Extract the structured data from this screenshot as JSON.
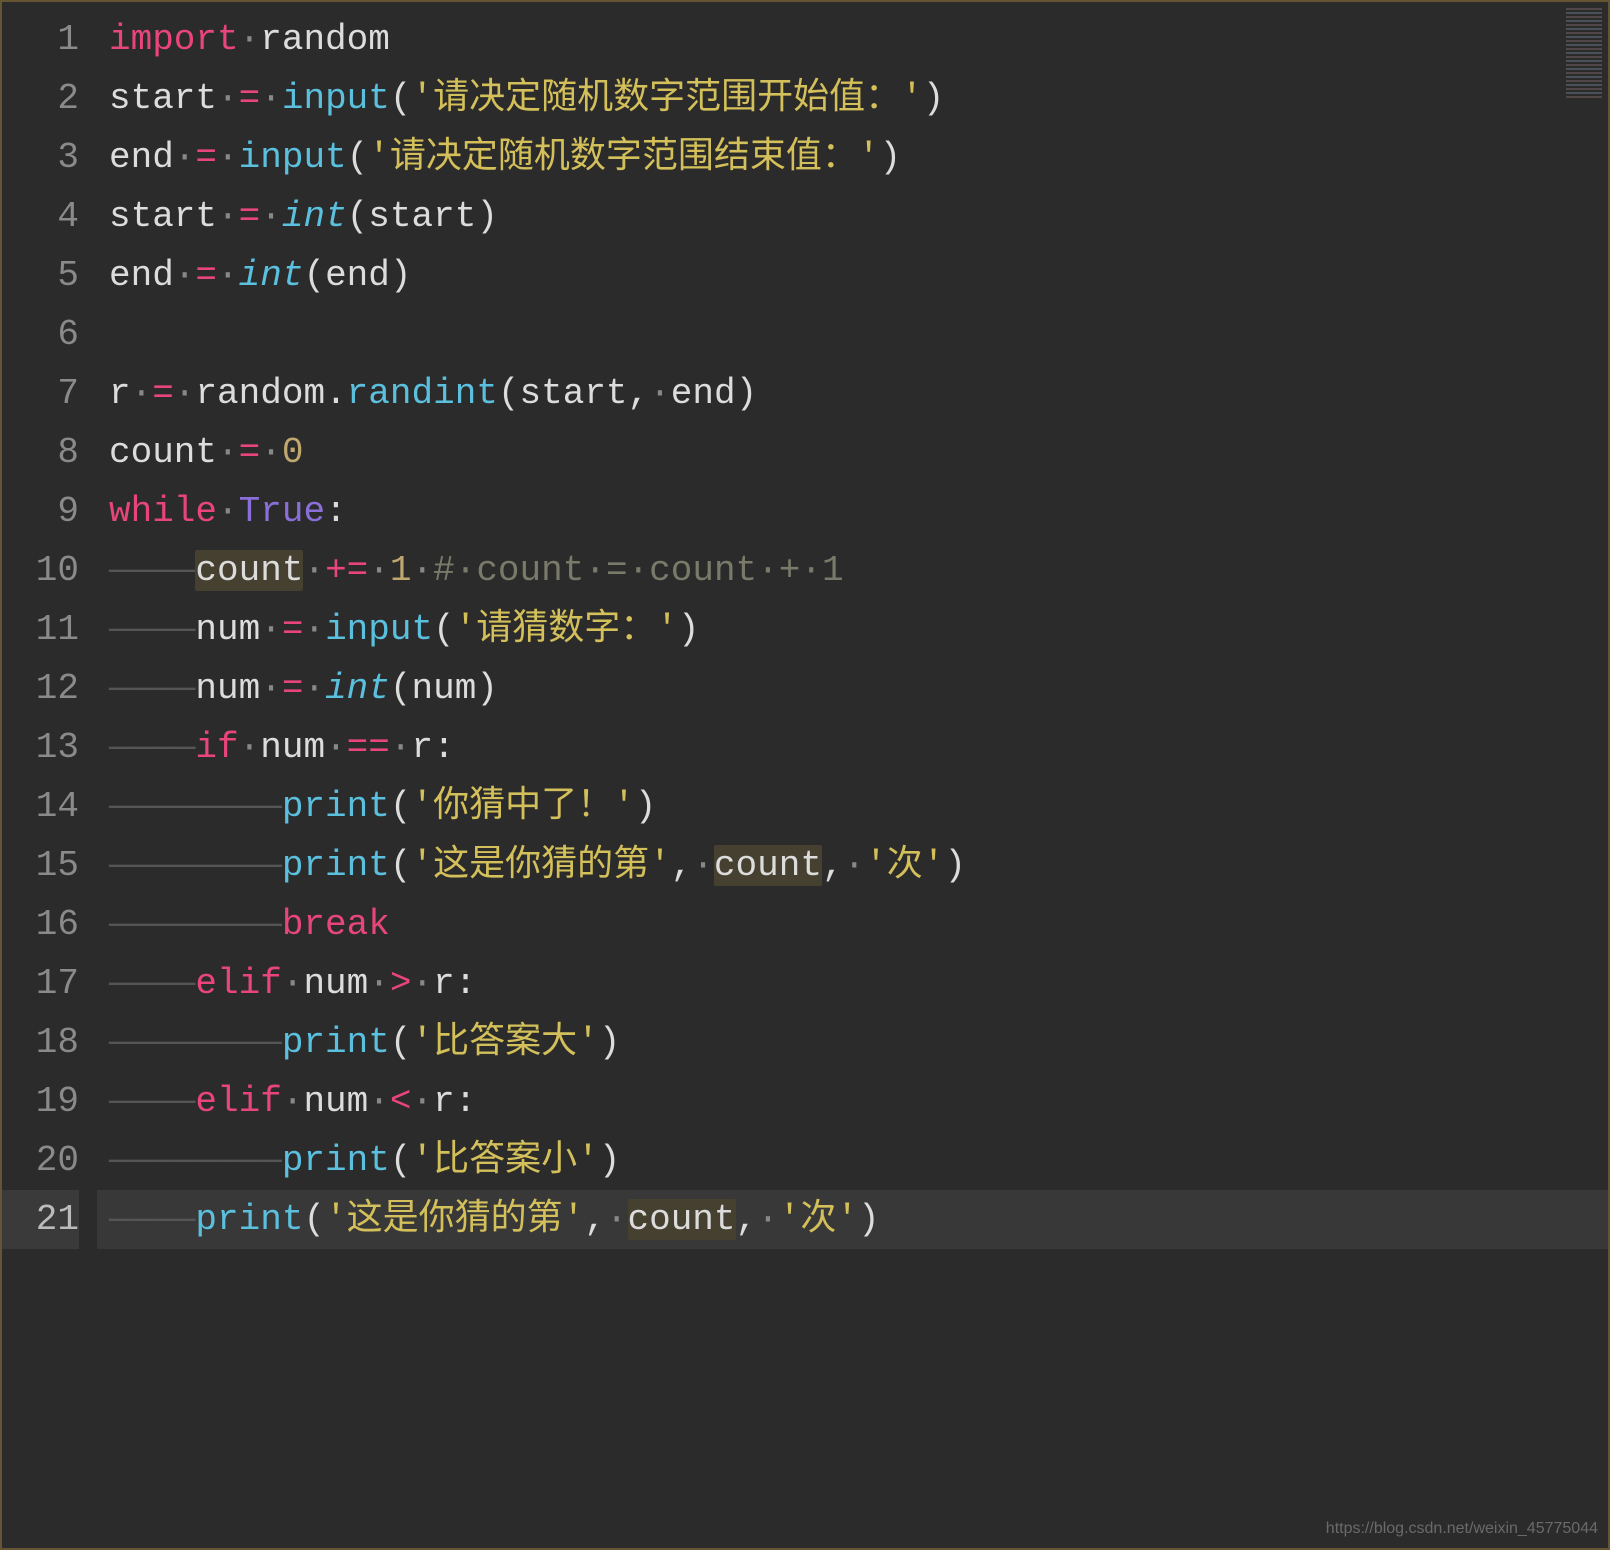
{
  "editor": {
    "line_numbers": [
      "1",
      "2",
      "3",
      "4",
      "5",
      "6",
      "7",
      "8",
      "9",
      "10",
      "11",
      "12",
      "13",
      "14",
      "15",
      "16",
      "17",
      "18",
      "19",
      "20",
      "21"
    ],
    "active_line": 21,
    "watermark": "https://blog.csdn.net/weixin_45775044",
    "tokens": [
      [
        {
          "t": "import",
          "c": "kw-import"
        },
        {
          "t": "·",
          "c": "ws-dot"
        },
        {
          "t": "random",
          "c": "ident"
        }
      ],
      [
        {
          "t": "start",
          "c": "ident"
        },
        {
          "t": "·",
          "c": "ws-dot"
        },
        {
          "t": "=",
          "c": "op"
        },
        {
          "t": "·",
          "c": "ws-dot"
        },
        {
          "t": "input",
          "c": "func-call"
        },
        {
          "t": "(",
          "c": "punct"
        },
        {
          "t": "'请决定随机数字范围开始值：'",
          "c": "string"
        },
        {
          "t": ")",
          "c": "punct"
        }
      ],
      [
        {
          "t": "end",
          "c": "ident"
        },
        {
          "t": "·",
          "c": "ws-dot"
        },
        {
          "t": "=",
          "c": "op"
        },
        {
          "t": "·",
          "c": "ws-dot"
        },
        {
          "t": "input",
          "c": "func-call"
        },
        {
          "t": "(",
          "c": "punct"
        },
        {
          "t": "'请决定随机数字范围结束值：'",
          "c": "string"
        },
        {
          "t": ")",
          "c": "punct"
        }
      ],
      [
        {
          "t": "start",
          "c": "ident"
        },
        {
          "t": "·",
          "c": "ws-dot"
        },
        {
          "t": "=",
          "c": "op"
        },
        {
          "t": "·",
          "c": "ws-dot"
        },
        {
          "t": "int",
          "c": "builtin"
        },
        {
          "t": "(",
          "c": "punct"
        },
        {
          "t": "start",
          "c": "ident"
        },
        {
          "t": ")",
          "c": "punct"
        }
      ],
      [
        {
          "t": "end",
          "c": "ident"
        },
        {
          "t": "·",
          "c": "ws-dot"
        },
        {
          "t": "=",
          "c": "op"
        },
        {
          "t": "·",
          "c": "ws-dot"
        },
        {
          "t": "int",
          "c": "builtin"
        },
        {
          "t": "(",
          "c": "punct"
        },
        {
          "t": "end",
          "c": "ident"
        },
        {
          "t": ")",
          "c": "punct"
        }
      ],
      [],
      [
        {
          "t": "r",
          "c": "ident"
        },
        {
          "t": "·",
          "c": "ws-dot"
        },
        {
          "t": "=",
          "c": "op"
        },
        {
          "t": "·",
          "c": "ws-dot"
        },
        {
          "t": "random",
          "c": "ident"
        },
        {
          "t": ".",
          "c": "punct"
        },
        {
          "t": "randint",
          "c": "func-call"
        },
        {
          "t": "(",
          "c": "punct"
        },
        {
          "t": "start",
          "c": "ident"
        },
        {
          "t": ",",
          "c": "punct"
        },
        {
          "t": "·",
          "c": "ws-dot"
        },
        {
          "t": "end",
          "c": "ident"
        },
        {
          "t": ")",
          "c": "punct"
        }
      ],
      [
        {
          "t": "count",
          "c": "ident"
        },
        {
          "t": "·",
          "c": "ws-dot"
        },
        {
          "t": "=",
          "c": "op"
        },
        {
          "t": "·",
          "c": "ws-dot"
        },
        {
          "t": "0",
          "c": "number"
        }
      ],
      [
        {
          "t": "while",
          "c": "kw-control"
        },
        {
          "t": "·",
          "c": "ws-dot"
        },
        {
          "t": "True",
          "c": "kw-bool"
        },
        {
          "t": ":",
          "c": "punct"
        }
      ],
      [
        {
          "t": "————",
          "c": "indent-guide"
        },
        {
          "t": "count",
          "c": "ident hl"
        },
        {
          "t": "·",
          "c": "ws-dot"
        },
        {
          "t": "+=",
          "c": "op"
        },
        {
          "t": "·",
          "c": "ws-dot"
        },
        {
          "t": "1",
          "c": "number"
        },
        {
          "t": "·",
          "c": "ws-dot"
        },
        {
          "t": "#·count·=·count·+·1",
          "c": "comment"
        }
      ],
      [
        {
          "t": "————",
          "c": "indent-guide"
        },
        {
          "t": "num",
          "c": "ident"
        },
        {
          "t": "·",
          "c": "ws-dot"
        },
        {
          "t": "=",
          "c": "op"
        },
        {
          "t": "·",
          "c": "ws-dot"
        },
        {
          "t": "input",
          "c": "func-call"
        },
        {
          "t": "(",
          "c": "punct"
        },
        {
          "t": "'请猜数字：'",
          "c": "string"
        },
        {
          "t": ")",
          "c": "punct"
        }
      ],
      [
        {
          "t": "————",
          "c": "indent-guide"
        },
        {
          "t": "num",
          "c": "ident"
        },
        {
          "t": "·",
          "c": "ws-dot"
        },
        {
          "t": "=",
          "c": "op"
        },
        {
          "t": "·",
          "c": "ws-dot"
        },
        {
          "t": "int",
          "c": "builtin"
        },
        {
          "t": "(",
          "c": "punct"
        },
        {
          "t": "num",
          "c": "ident"
        },
        {
          "t": ")",
          "c": "punct"
        }
      ],
      [
        {
          "t": "————",
          "c": "indent-guide"
        },
        {
          "t": "if",
          "c": "kw-control"
        },
        {
          "t": "·",
          "c": "ws-dot"
        },
        {
          "t": "num",
          "c": "ident"
        },
        {
          "t": "·",
          "c": "ws-dot"
        },
        {
          "t": "==",
          "c": "op"
        },
        {
          "t": "·",
          "c": "ws-dot"
        },
        {
          "t": "r",
          "c": "ident"
        },
        {
          "t": ":",
          "c": "punct"
        }
      ],
      [
        {
          "t": "————————",
          "c": "indent-guide"
        },
        {
          "t": "print",
          "c": "func-call"
        },
        {
          "t": "(",
          "c": "punct"
        },
        {
          "t": "'你猜中了！'",
          "c": "string"
        },
        {
          "t": ")",
          "c": "punct"
        }
      ],
      [
        {
          "t": "————————",
          "c": "indent-guide"
        },
        {
          "t": "print",
          "c": "func-call"
        },
        {
          "t": "(",
          "c": "punct"
        },
        {
          "t": "'这是你猜的第'",
          "c": "string"
        },
        {
          "t": ",",
          "c": "punct"
        },
        {
          "t": "·",
          "c": "ws-dot"
        },
        {
          "t": "count",
          "c": "ident hl"
        },
        {
          "t": ",",
          "c": "punct"
        },
        {
          "t": "·",
          "c": "ws-dot"
        },
        {
          "t": "'次'",
          "c": "string"
        },
        {
          "t": ")",
          "c": "punct"
        }
      ],
      [
        {
          "t": "————————",
          "c": "indent-guide"
        },
        {
          "t": "break",
          "c": "kw-control"
        }
      ],
      [
        {
          "t": "————",
          "c": "indent-guide"
        },
        {
          "t": "elif",
          "c": "kw-control"
        },
        {
          "t": "·",
          "c": "ws-dot"
        },
        {
          "t": "num",
          "c": "ident"
        },
        {
          "t": "·",
          "c": "ws-dot"
        },
        {
          "t": ">",
          "c": "op"
        },
        {
          "t": "·",
          "c": "ws-dot"
        },
        {
          "t": "r",
          "c": "ident"
        },
        {
          "t": ":",
          "c": "punct"
        }
      ],
      [
        {
          "t": "————————",
          "c": "indent-guide"
        },
        {
          "t": "print",
          "c": "func-call"
        },
        {
          "t": "(",
          "c": "punct"
        },
        {
          "t": "'比答案大'",
          "c": "string"
        },
        {
          "t": ")",
          "c": "punct"
        }
      ],
      [
        {
          "t": "————",
          "c": "indent-guide"
        },
        {
          "t": "elif",
          "c": "kw-control"
        },
        {
          "t": "·",
          "c": "ws-dot"
        },
        {
          "t": "num",
          "c": "ident"
        },
        {
          "t": "·",
          "c": "ws-dot"
        },
        {
          "t": "<",
          "c": "op"
        },
        {
          "t": "·",
          "c": "ws-dot"
        },
        {
          "t": "r",
          "c": "ident"
        },
        {
          "t": ":",
          "c": "punct"
        }
      ],
      [
        {
          "t": "————————",
          "c": "indent-guide"
        },
        {
          "t": "print",
          "c": "func-call"
        },
        {
          "t": "(",
          "c": "punct"
        },
        {
          "t": "'比答案小'",
          "c": "string"
        },
        {
          "t": ")",
          "c": "punct"
        }
      ],
      [
        {
          "t": "————",
          "c": "indent-guide"
        },
        {
          "t": "print",
          "c": "func-call"
        },
        {
          "t": "(",
          "c": "punct"
        },
        {
          "t": "'这是你猜的第'",
          "c": "string"
        },
        {
          "t": ",",
          "c": "punct"
        },
        {
          "t": "·",
          "c": "ws-dot"
        },
        {
          "t": "count",
          "c": "ident hl"
        },
        {
          "t": ",",
          "c": "punct"
        },
        {
          "t": "·",
          "c": "ws-dot"
        },
        {
          "t": "'次'",
          "c": "string"
        },
        {
          "t": ")",
          "c": "punct"
        }
      ]
    ]
  }
}
